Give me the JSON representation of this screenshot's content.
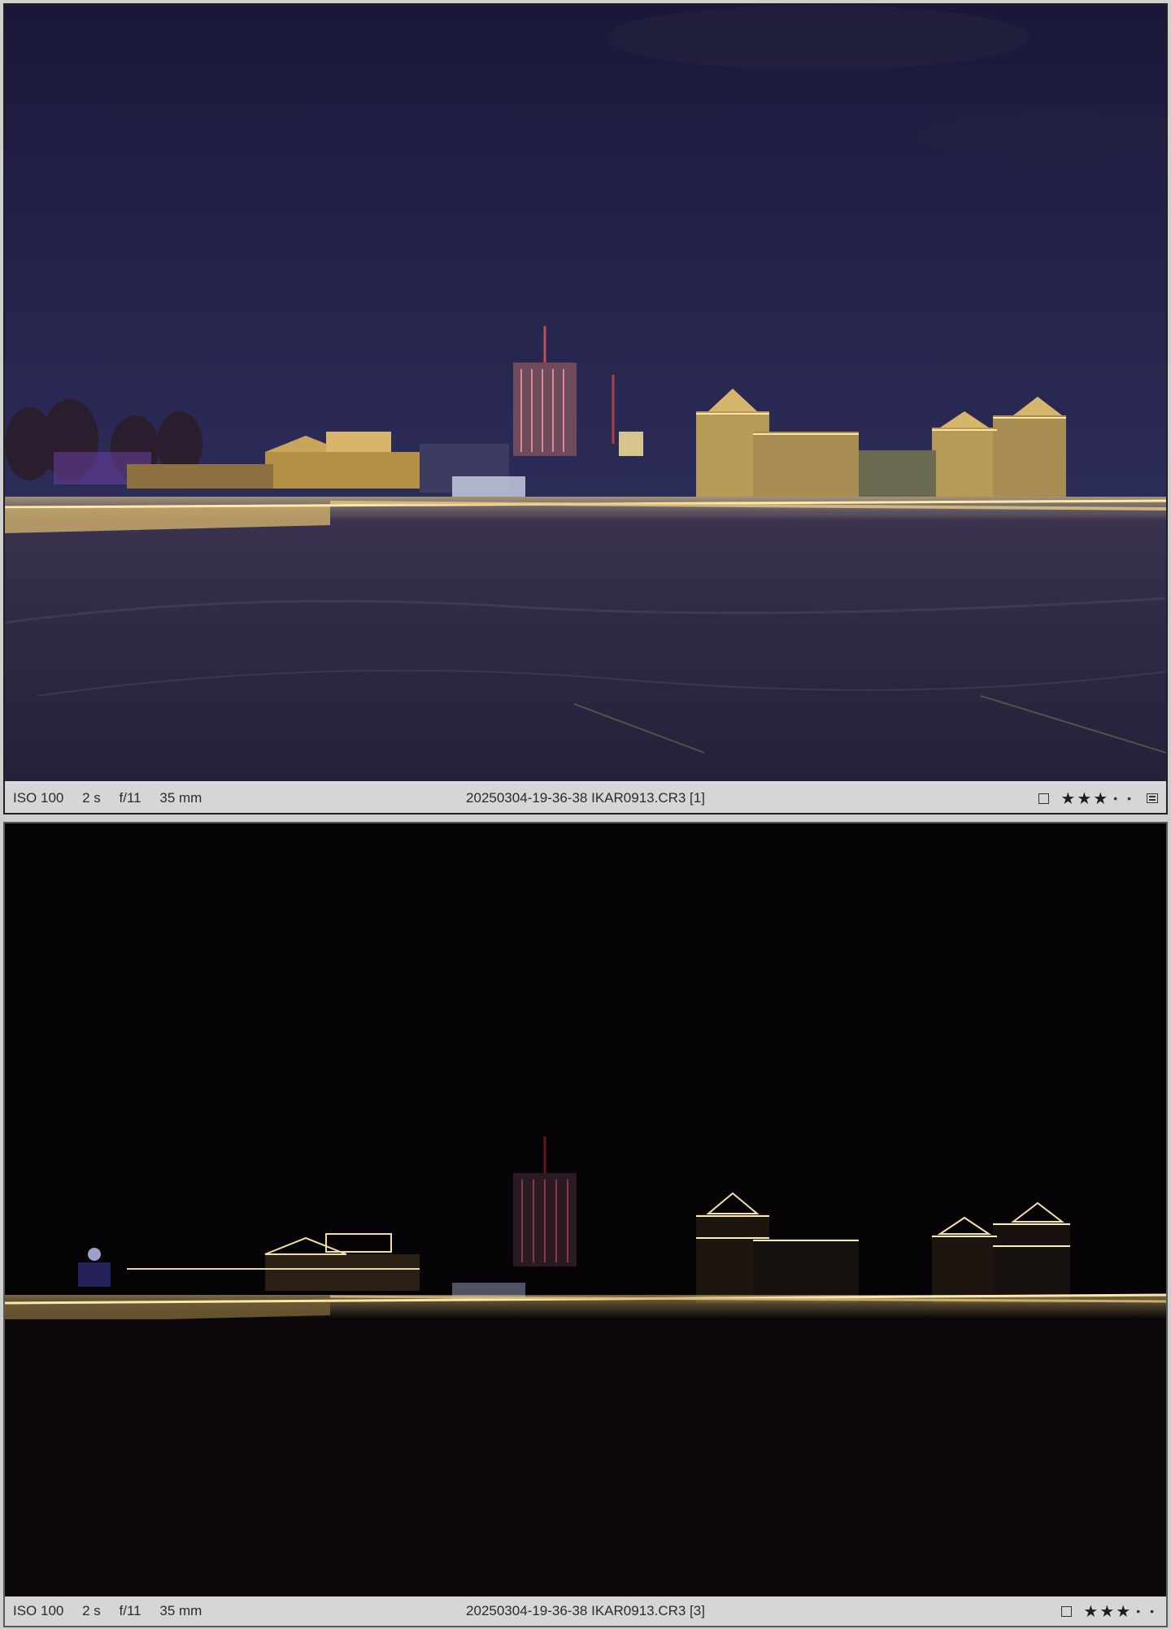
{
  "panels": [
    {
      "exposure": {
        "iso": "ISO 100",
        "shutter": "2 s",
        "aperture": "f/11",
        "focal_length": "35 mm"
      },
      "filename": "20250304-19-36-38 IKAR0913.CR3 [1]",
      "rating": 3,
      "rating_max": 5,
      "flag": "unflagged",
      "photo_icon": "night-city-embankment-photo",
      "metadata_icon": "metadata-icon"
    },
    {
      "exposure": {
        "iso": "ISO 100",
        "shutter": "2 s",
        "aperture": "f/11",
        "focal_length": "35 mm"
      },
      "filename": "20250304-19-36-38 IKAR0913.CR3 [3]",
      "rating": 3,
      "rating_max": 5,
      "flag": "unflagged",
      "photo_icon": "night-city-embankment-photo-dark"
    }
  ]
}
